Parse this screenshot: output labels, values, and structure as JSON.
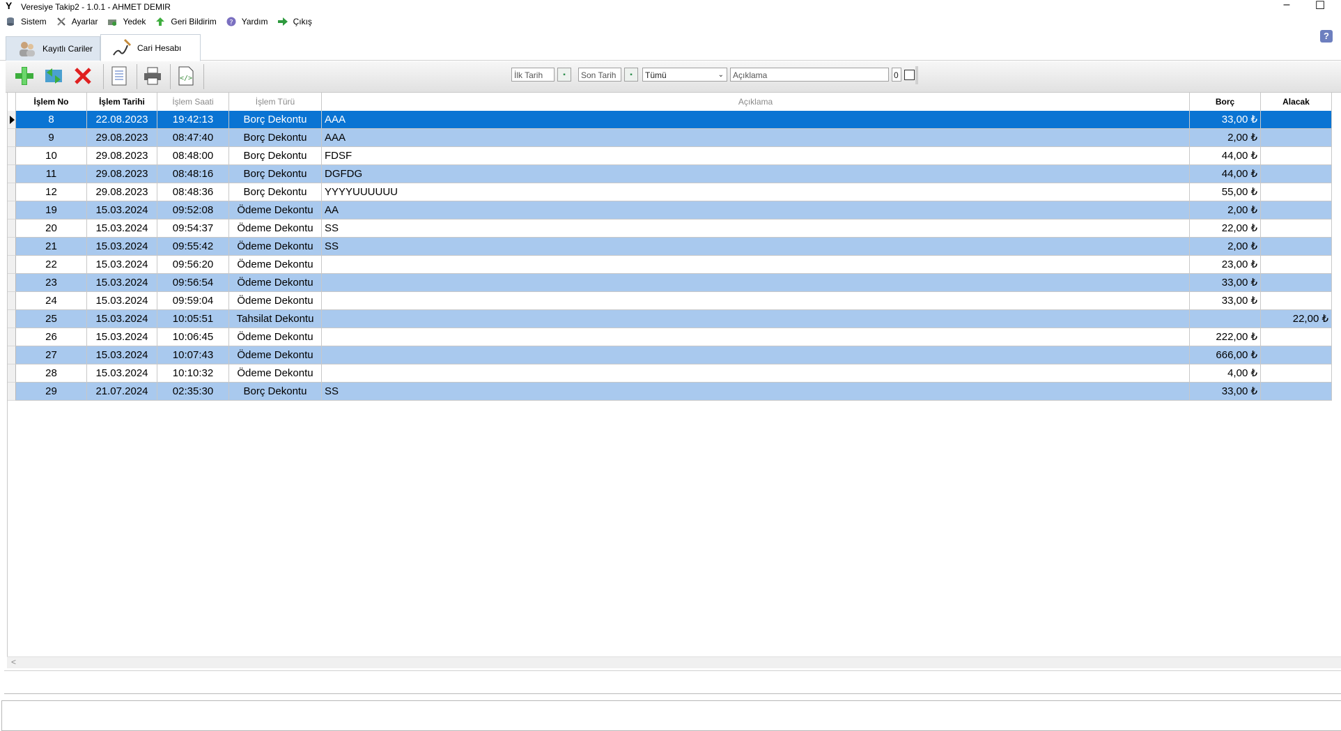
{
  "window": {
    "title": "Veresiye Takip2 - 1.0.1 - AHMET DEMIR",
    "minimize": "–",
    "maximize": "☐"
  },
  "menu": [
    {
      "label": "Sistem",
      "icon": "database-icon"
    },
    {
      "label": "Ayarlar",
      "icon": "tools-icon"
    },
    {
      "label": "Yedek",
      "icon": "backup-icon"
    },
    {
      "label": "Geri Bildirim",
      "icon": "arrow-up-icon"
    },
    {
      "label": "Yardım",
      "icon": "help-icon"
    },
    {
      "label": "Çıkış",
      "icon": "exit-icon"
    }
  ],
  "tabs": [
    {
      "label": "Kayıtlı Cariler",
      "active": false
    },
    {
      "label": "Cari Hesabı",
      "active": true
    }
  ],
  "toolbar": {
    "buttons": [
      "add-icon",
      "refresh-icon",
      "delete-icon",
      "report-icon",
      "print-icon",
      "export-icon"
    ]
  },
  "filter": {
    "start_date_placeholder": "İlk Tarih",
    "end_date_placeholder": "Son Tarih",
    "type_selected": "Tümü",
    "description_placeholder": "Açıklama",
    "count": "0"
  },
  "table": {
    "columns": [
      "İşlem No",
      "İşlem Tarihi",
      "İşlem Saati",
      "İşlem Türü",
      "Açıklama",
      "Borç",
      "Alacak"
    ],
    "rows": [
      [
        "8",
        "22.08.2023",
        "19:42:13",
        "Borç Dekontu",
        "AAA",
        "33,00 ₺",
        ""
      ],
      [
        "9",
        "29.08.2023",
        "08:47:40",
        "Borç Dekontu",
        "AAA",
        "2,00 ₺",
        ""
      ],
      [
        "10",
        "29.08.2023",
        "08:48:00",
        "Borç Dekontu",
        "FDSF",
        "44,00 ₺",
        ""
      ],
      [
        "11",
        "29.08.2023",
        "08:48:16",
        "Borç Dekontu",
        "DGFDG",
        "44,00 ₺",
        ""
      ],
      [
        "12",
        "29.08.2023",
        "08:48:36",
        "Borç Dekontu",
        "YYYYUUUUUU",
        "55,00 ₺",
        ""
      ],
      [
        "19",
        "15.03.2024",
        "09:52:08",
        "Ödeme Dekontu",
        "AA",
        "2,00 ₺",
        ""
      ],
      [
        "20",
        "15.03.2024",
        "09:54:37",
        "Ödeme Dekontu",
        "SS",
        "22,00 ₺",
        ""
      ],
      [
        "21",
        "15.03.2024",
        "09:55:42",
        "Ödeme Dekontu",
        "SS",
        "2,00 ₺",
        ""
      ],
      [
        "22",
        "15.03.2024",
        "09:56:20",
        "Ödeme Dekontu",
        "",
        "23,00 ₺",
        ""
      ],
      [
        "23",
        "15.03.2024",
        "09:56:54",
        "Ödeme Dekontu",
        "",
        "33,00 ₺",
        ""
      ],
      [
        "24",
        "15.03.2024",
        "09:59:04",
        "Ödeme Dekontu",
        "",
        "33,00 ₺",
        ""
      ],
      [
        "25",
        "15.03.2024",
        "10:05:51",
        "Tahsilat Dekontu",
        "",
        "",
        "22,00 ₺"
      ],
      [
        "26",
        "15.03.2024",
        "10:06:45",
        "Ödeme Dekontu",
        "",
        "222,00 ₺",
        ""
      ],
      [
        "27",
        "15.03.2024",
        "10:07:43",
        "Ödeme Dekontu",
        "",
        "666,00 ₺",
        ""
      ],
      [
        "28",
        "15.03.2024",
        "10:10:32",
        "Ödeme Dekontu",
        "",
        "4,00 ₺",
        ""
      ],
      [
        "29",
        "21.07.2024",
        "02:35:30",
        "Borç Dekontu",
        "SS",
        "33,00 ₺",
        ""
      ]
    ],
    "selected_row": 0
  },
  "colors": {
    "selected_row": "#0a74d3",
    "alt_row": "#a9c9ee"
  }
}
